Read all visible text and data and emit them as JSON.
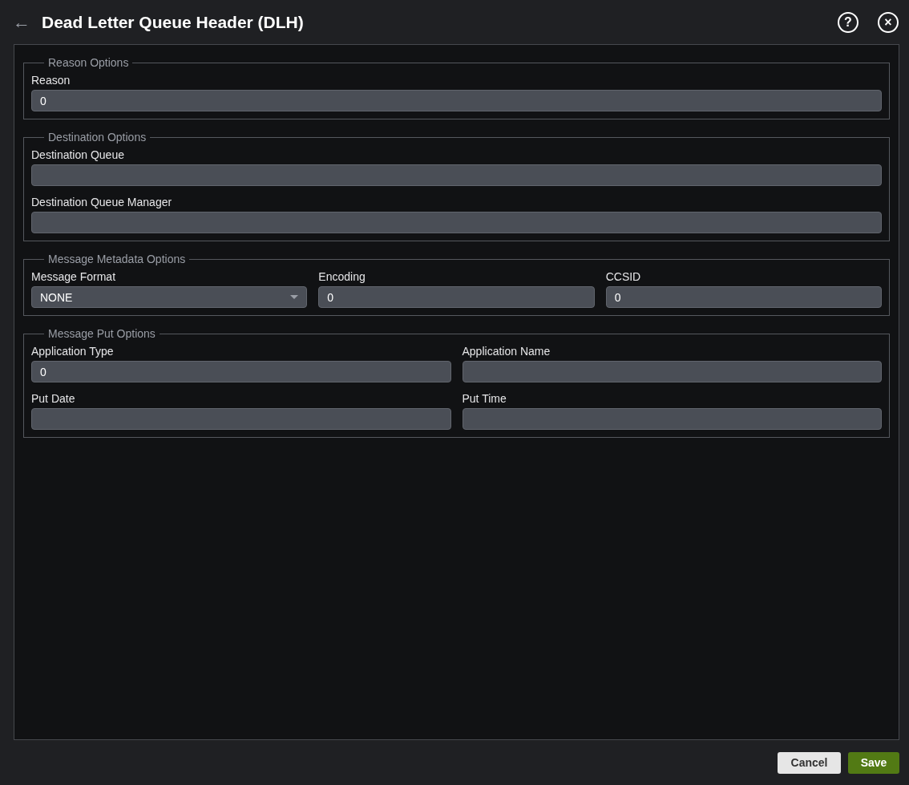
{
  "header": {
    "title": "Dead Letter Queue Header (DLH)",
    "back_icon": "←",
    "help_icon": "?",
    "close_icon": "×"
  },
  "sections": [
    {
      "legend": "Reason Options",
      "rows": [
        [
          {
            "label": "Reason",
            "kind": "text",
            "value": "0"
          }
        ]
      ]
    },
    {
      "legend": "Destination Options",
      "rows": [
        [
          {
            "label": "Destination Queue",
            "kind": "text"
          }
        ],
        [
          {
            "label": "Destination Queue Manager",
            "kind": "text"
          }
        ]
      ]
    },
    {
      "legend": "Message Metadata Options",
      "rows": [
        [
          {
            "label": "Message Format",
            "kind": "select",
            "value": "NONE"
          },
          {
            "label": "Encoding",
            "kind": "text",
            "value": "0"
          },
          {
            "label": "CCSID",
            "kind": "text",
            "value": "0"
          }
        ]
      ]
    },
    {
      "legend": "Message Put Options",
      "rows": [
        [
          {
            "label": "Application Type",
            "kind": "text",
            "value": "0"
          },
          {
            "label": "Application Name",
            "kind": "text"
          }
        ],
        [
          {
            "label": "Put Date",
            "kind": "text"
          },
          {
            "label": "Put Time",
            "kind": "text"
          }
        ]
      ]
    }
  ],
  "buttons": [
    {
      "label": "Cancel",
      "kind": "secondary"
    },
    {
      "label": "Save",
      "kind": "primary"
    }
  ]
}
